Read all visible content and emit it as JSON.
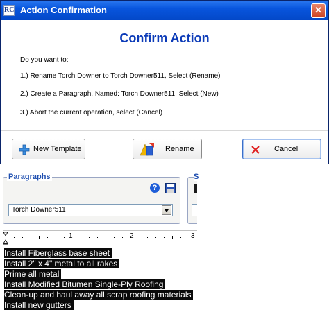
{
  "dialog": {
    "title": "Action Confirmation",
    "app_icon_text": "RC",
    "close_glyph": "✕",
    "heading": "Confirm Action",
    "prompt": "Do you want to:",
    "options": [
      "1.)  Rename Torch Downer to Torch Downer511, Select (Rename)",
      "2.) Create a Paragraph, Named: Torch Downer511, Select (New)",
      "3.) Abort the current operation, select (Cancel)"
    ],
    "buttons": {
      "new_template": "New Template",
      "rename": "Rename",
      "cancel": "Cancel"
    }
  },
  "paragraphs": {
    "label": "Paragraphs",
    "help_glyph": "?",
    "selected": "Torch Downer511"
  },
  "right_group": {
    "label": "S"
  },
  "ruler": {
    "marks": [
      "1",
      "2",
      "3"
    ]
  },
  "content_lines": [
    "Install Fiberglass base sheet",
    "Install 2\" x 4\" metal to all rakes",
    "Prime all metal",
    "Install Modified Bitumen Single-Ply Roofing",
    "Clean-up and haul away all scrap roofing materials",
    "Install new gutters"
  ],
  "colors": {
    "title_bar": "#0855dd",
    "heading": "#0c3bb8",
    "group_label": "#1f4fb0",
    "highlight": "#0a0a0a"
  }
}
